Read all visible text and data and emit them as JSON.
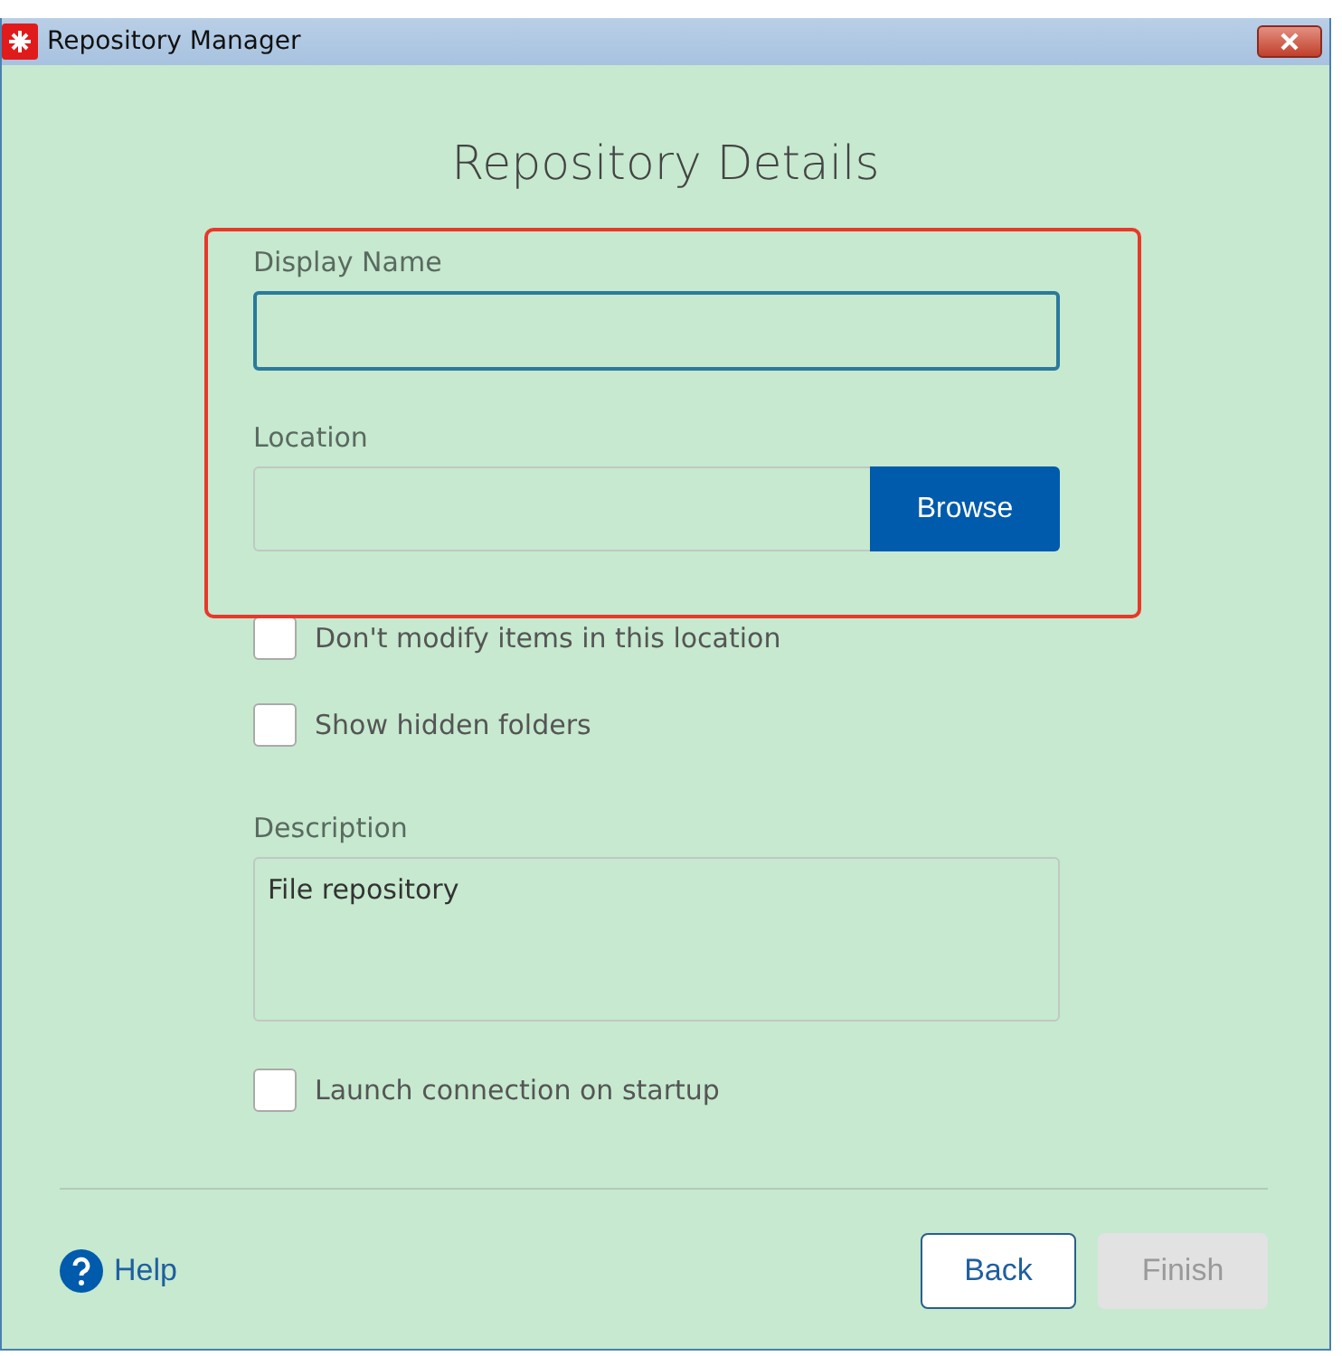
{
  "window": {
    "title": "Repository Manager"
  },
  "heading": "Repository Details",
  "display_name": {
    "label": "Display Name",
    "focused": true
  },
  "location": {
    "label": "Location",
    "button": "Browse"
  },
  "options": [
    {
      "label": "Don't modify items in this location",
      "checked": false
    },
    {
      "label": "Show hidden folders",
      "checked": false
    }
  ],
  "description": {
    "label": "Description",
    "value": "File repository"
  },
  "launch_option": {
    "label": "Launch connection on startup",
    "checked": false
  },
  "footer": {
    "help": "Help",
    "buttons": [
      {
        "label": "Back",
        "disabled": false
      },
      {
        "label": "Finish",
        "disabled": true
      }
    ]
  }
}
